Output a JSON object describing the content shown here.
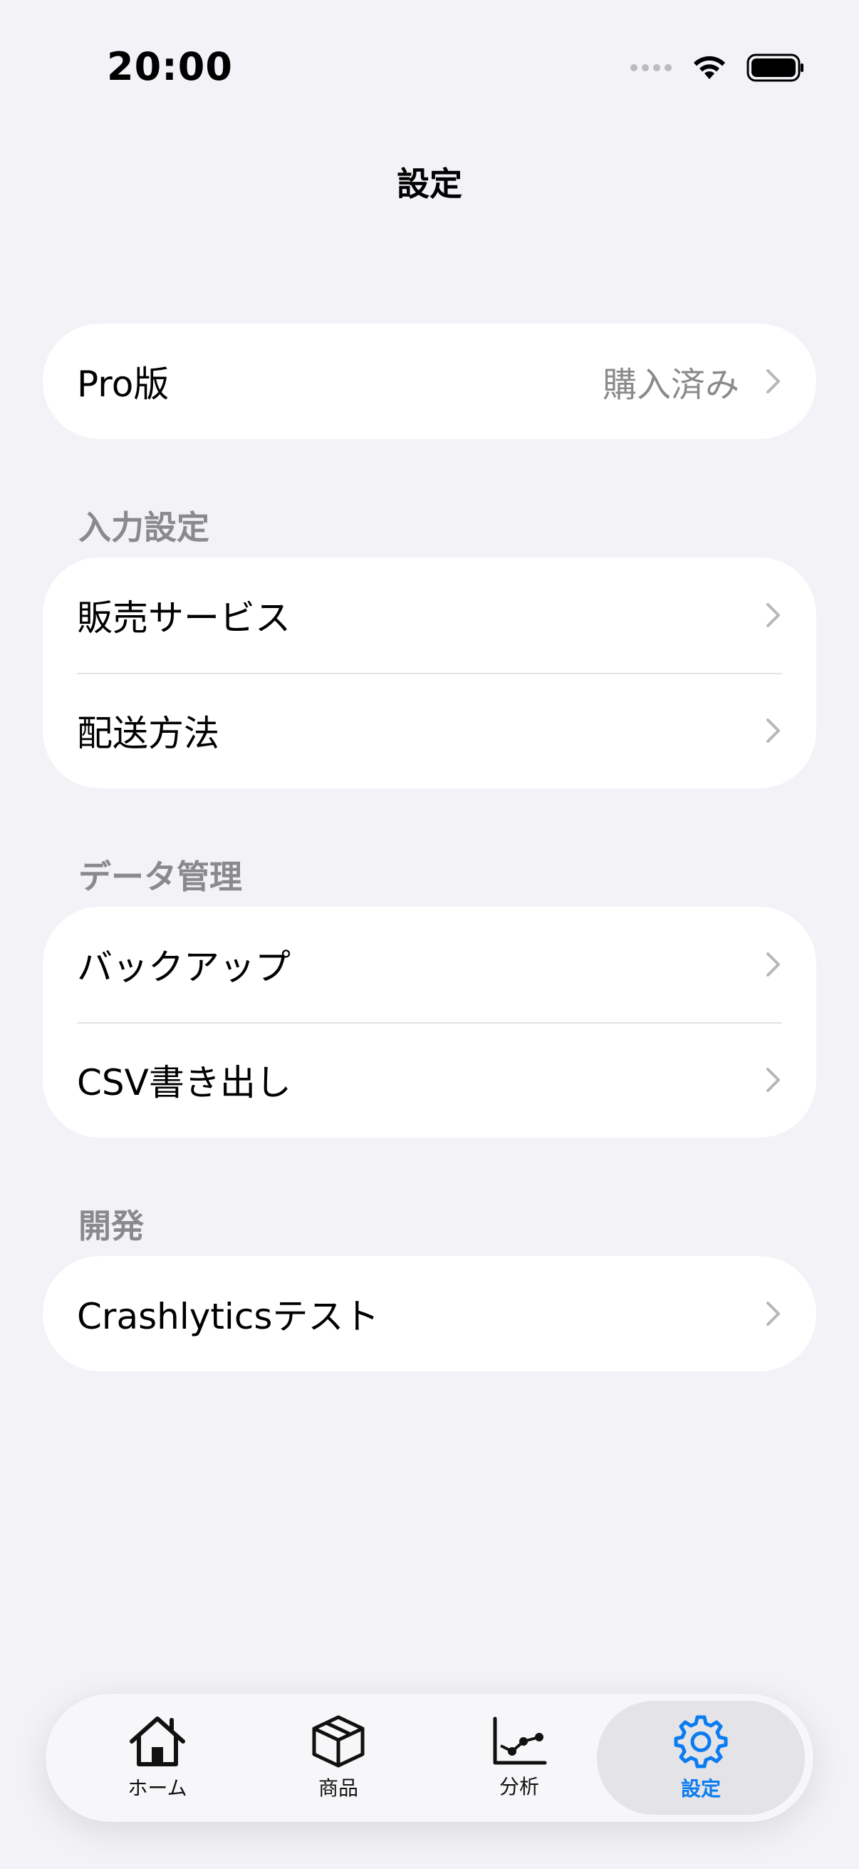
{
  "status_bar": {
    "time": "20:00"
  },
  "nav": {
    "title": "設定"
  },
  "pro": {
    "label": "Pro版",
    "value": "購入済み"
  },
  "sections": {
    "input": {
      "header": "入力設定",
      "items": [
        "販売サービス",
        "配送方法"
      ]
    },
    "data": {
      "header": "データ管理",
      "items": [
        "バックアップ",
        "CSV書き出し"
      ]
    },
    "dev": {
      "header": "開発",
      "items": [
        "Crashlyticsテスト"
      ]
    }
  },
  "tabbar": {
    "active_color": "#0a7cf0",
    "tabs": [
      {
        "label": "ホーム",
        "icon": "house-icon"
      },
      {
        "label": "商品",
        "icon": "box-icon"
      },
      {
        "label": "分析",
        "icon": "chart-line-icon"
      },
      {
        "label": "設定",
        "icon": "gear-icon"
      }
    ]
  }
}
